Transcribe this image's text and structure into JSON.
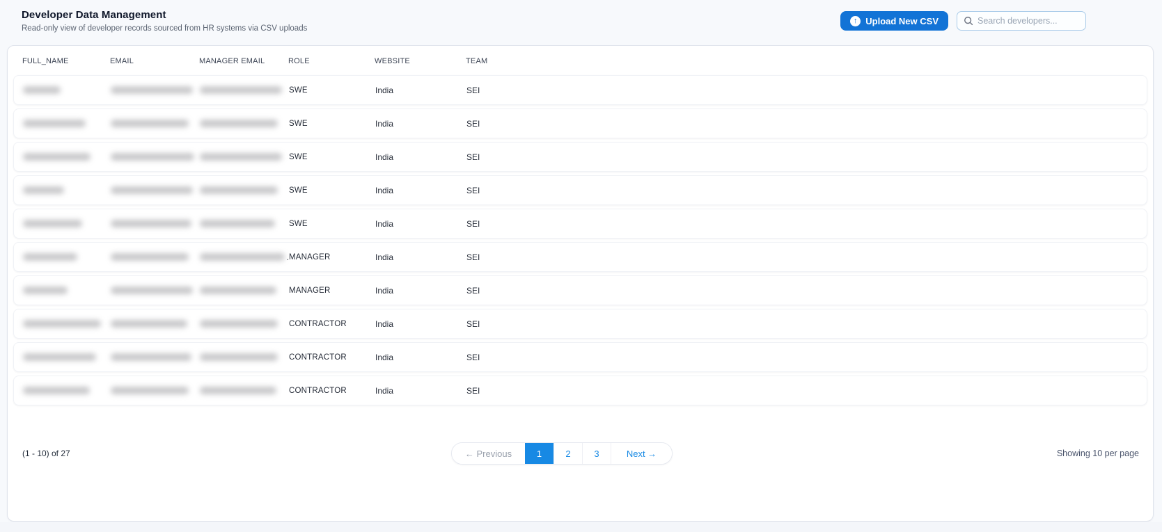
{
  "header": {
    "title": "Developer Data Management",
    "subtitle": "Read-only view of developer records sourced from HR systems via CSV uploads",
    "upload_button": "Upload New CSV",
    "upload_icon": "↑",
    "search_placeholder": "Search developers..."
  },
  "table": {
    "columns": [
      "FULL_NAME",
      "EMAIL",
      "MANAGER EMAIL",
      "ROLE",
      "WEBSITE",
      "TEAM"
    ],
    "redacted_note": "FULL_NAME, EMAIL and MANAGER EMAIL cell values are blurred/redacted in the screenshot",
    "rows": [
      {
        "full_name_redacted_width": 54,
        "email_redacted_width": 118,
        "manager_email_redacted_width": 118,
        "manager_email_suffix": "",
        "role": "SWE",
        "website": "India",
        "team": "SEI"
      },
      {
        "full_name_redacted_width": 90,
        "email_redacted_width": 112,
        "manager_email_redacted_width": 112,
        "manager_email_suffix": "",
        "role": "SWE",
        "website": "India",
        "team": "SEI"
      },
      {
        "full_name_redacted_width": 97,
        "email_redacted_width": 120,
        "manager_email_redacted_width": 118,
        "manager_email_suffix": "",
        "role": "SWE",
        "website": "India",
        "team": "SEI"
      },
      {
        "full_name_redacted_width": 59,
        "email_redacted_width": 118,
        "manager_email_redacted_width": 112,
        "manager_email_suffix": "",
        "role": "SWE",
        "website": "India",
        "team": "SEI"
      },
      {
        "full_name_redacted_width": 85,
        "email_redacted_width": 116,
        "manager_email_redacted_width": 108,
        "manager_email_suffix": "",
        "role": "SWE",
        "website": "India",
        "team": "SEI"
      },
      {
        "full_name_redacted_width": 78,
        "email_redacted_width": 112,
        "manager_email_redacted_width": 122,
        "manager_email_suffix": ".",
        "role": "MANAGER",
        "website": "India",
        "team": "SEI"
      },
      {
        "full_name_redacted_width": 64,
        "email_redacted_width": 118,
        "manager_email_redacted_width": 110,
        "manager_email_suffix": "",
        "role": "MANAGER",
        "website": "India",
        "team": "SEI"
      },
      {
        "full_name_redacted_width": 112,
        "email_redacted_width": 110,
        "manager_email_redacted_width": 112,
        "manager_email_suffix": "",
        "role": "CONTRACTOR",
        "website": "India",
        "team": "SEI"
      },
      {
        "full_name_redacted_width": 105,
        "email_redacted_width": 116,
        "manager_email_redacted_width": 112,
        "manager_email_suffix": "",
        "role": "CONTRACTOR",
        "website": "India",
        "team": "SEI"
      },
      {
        "full_name_redacted_width": 96,
        "email_redacted_width": 112,
        "manager_email_redacted_width": 110,
        "manager_email_suffix": "",
        "role": "CONTRACTOR",
        "website": "India",
        "team": "SEI"
      }
    ]
  },
  "pagination": {
    "range_label": "(1 - 10) of 27",
    "previous_label": "← Previous",
    "pages": [
      "1",
      "2",
      "3"
    ],
    "active_page": "1",
    "next_label": "Next →",
    "per_page_label": "Showing 10 per page"
  },
  "colors": {
    "accent_blue": "#1273d6",
    "pagination_blue": "#1789e4",
    "page_background": "#f7f9fc",
    "card_border": "#dfe3ec",
    "search_border": "#a9cbe9"
  }
}
